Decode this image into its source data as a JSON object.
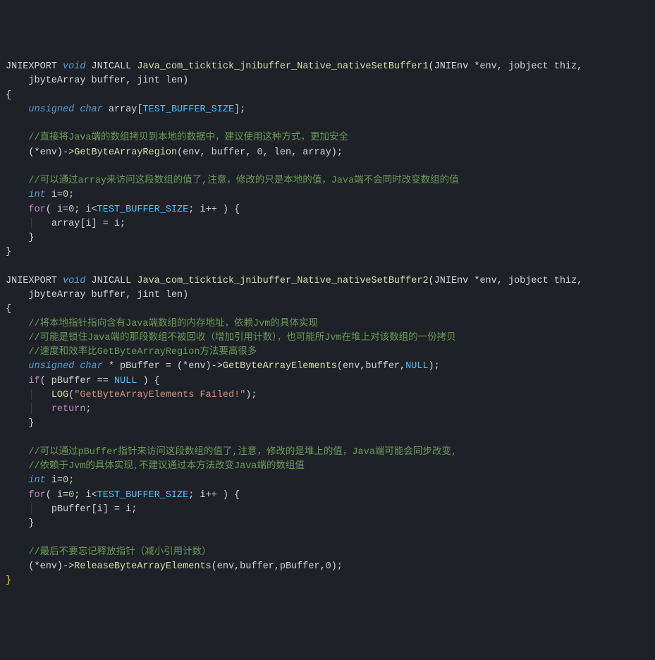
{
  "code": {
    "lines": [
      [
        {
          "t": "JNIEXPORT",
          "c": "ident"
        },
        {
          "t": " "
        },
        {
          "t": "void",
          "c": "kw-type"
        },
        {
          "t": " "
        },
        {
          "t": "JNICALL",
          "c": "ident"
        },
        {
          "t": " "
        },
        {
          "t": "Java_com_ticktick_jnibuffer_Native_nativeSetBuffer1",
          "c": "fn-name"
        },
        {
          "t": "(JNIEnv *env, jobject thiz, ",
          "c": "ident"
        }
      ],
      [
        {
          "t": "    jbyteArray buffer, jint len)",
          "c": "ident"
        }
      ],
      [
        {
          "t": "{",
          "c": "punc"
        }
      ],
      [
        {
          "t": "    "
        },
        {
          "t": "unsigned",
          "c": "kw-type"
        },
        {
          "t": " "
        },
        {
          "t": "char",
          "c": "kw-type"
        },
        {
          "t": " "
        },
        {
          "t": "array[",
          "c": "ident"
        },
        {
          "t": "TEST_BUFFER_SIZE",
          "c": "const"
        },
        {
          "t": "];",
          "c": "punc"
        }
      ],
      [
        {
          "t": " "
        }
      ],
      [
        {
          "t": "    "
        },
        {
          "t": "//直接将Java端的数组拷贝到本地的数据中，建议使用这种方式，更加安全",
          "c": "comment"
        }
      ],
      [
        {
          "t": "    (*env)->",
          "c": "ident"
        },
        {
          "t": "GetByteArrayRegion",
          "c": "fn-call"
        },
        {
          "t": "(env, buffer, ",
          "c": "ident"
        },
        {
          "t": "0",
          "c": "num"
        },
        {
          "t": ", len, array);",
          "c": "ident"
        }
      ],
      [
        {
          "t": " "
        }
      ],
      [
        {
          "t": "    "
        },
        {
          "t": "//可以通过array来访问这段数组的值了,注意，修改的只是本地的值，Java端不会同时改变数组的值",
          "c": "comment"
        }
      ],
      [
        {
          "t": "    "
        },
        {
          "t": "int",
          "c": "kw-type"
        },
        {
          "t": " "
        },
        {
          "t": "i=",
          "c": "ident"
        },
        {
          "t": "0",
          "c": "num"
        },
        {
          "t": ";",
          "c": "punc"
        }
      ],
      [
        {
          "t": "    "
        },
        {
          "t": "for",
          "c": "kw-ctrl"
        },
        {
          "t": "( i=",
          "c": "ident"
        },
        {
          "t": "0",
          "c": "num"
        },
        {
          "t": "; i<",
          "c": "ident"
        },
        {
          "t": "TEST_BUFFER_SIZE",
          "c": "const"
        },
        {
          "t": "; i++ ) {",
          "c": "ident"
        }
      ],
      [
        {
          "t": "    "
        },
        {
          "t": "│",
          "c": "indent-guide"
        },
        {
          "t": "   array[i] = i;",
          "c": "ident"
        }
      ],
      [
        {
          "t": "    }",
          "c": "punc"
        }
      ],
      [
        {
          "t": "}",
          "c": "punc"
        }
      ],
      [
        {
          "t": " "
        }
      ],
      [
        {
          "t": "JNIEXPORT",
          "c": "ident"
        },
        {
          "t": " "
        },
        {
          "t": "void",
          "c": "kw-type"
        },
        {
          "t": " "
        },
        {
          "t": "JNICALL",
          "c": "ident"
        },
        {
          "t": " "
        },
        {
          "t": "Java_com_ticktick_jnibuffer_Native_nativeSetBuffer2",
          "c": "fn-name"
        },
        {
          "t": "(JNIEnv *env, jobject thiz, ",
          "c": "ident"
        }
      ],
      [
        {
          "t": "    jbyteArray buffer, jint len)",
          "c": "ident"
        }
      ],
      [
        {
          "t": "{",
          "c": "punc"
        }
      ],
      [
        {
          "t": "    "
        },
        {
          "t": "//将本地指针指向含有Java端数组的内存地址，依赖Jvm的具体实现",
          "c": "comment"
        }
      ],
      [
        {
          "t": "    "
        },
        {
          "t": "//可能是锁住Java端的那段数组不被回收（增加引用计数），也可能所Jvm在堆上对该数组的一份拷贝",
          "c": "comment"
        }
      ],
      [
        {
          "t": "    "
        },
        {
          "t": "//速度和效率比GetByteArrayRegion方法要高很多",
          "c": "comment"
        }
      ],
      [
        {
          "t": "    "
        },
        {
          "t": "unsigned",
          "c": "kw-type"
        },
        {
          "t": " "
        },
        {
          "t": "char",
          "c": "kw-type"
        },
        {
          "t": " * pBuffer = (*env)->",
          "c": "ident"
        },
        {
          "t": "GetByteArrayElements",
          "c": "fn-call"
        },
        {
          "t": "(env,buffer,",
          "c": "ident"
        },
        {
          "t": "NULL",
          "c": "const"
        },
        {
          "t": ");",
          "c": "punc"
        }
      ],
      [
        {
          "t": "    "
        },
        {
          "t": "if",
          "c": "kw-ctrl"
        },
        {
          "t": "( pBuffer == ",
          "c": "ident"
        },
        {
          "t": "NULL",
          "c": "const"
        },
        {
          "t": " ) {",
          "c": "ident"
        }
      ],
      [
        {
          "t": "    "
        },
        {
          "t": "│",
          "c": "indent-guide"
        },
        {
          "t": "   "
        },
        {
          "t": "LOG",
          "c": "fn-call"
        },
        {
          "t": "(",
          "c": "punc"
        },
        {
          "t": "\"GetByteArrayElements Failed!\"",
          "c": "str"
        },
        {
          "t": ");",
          "c": "punc"
        }
      ],
      [
        {
          "t": "    "
        },
        {
          "t": "│",
          "c": "indent-guide"
        },
        {
          "t": "   "
        },
        {
          "t": "return",
          "c": "kw-ret"
        },
        {
          "t": ";",
          "c": "punc"
        }
      ],
      [
        {
          "t": "    }",
          "c": "punc"
        }
      ],
      [
        {
          "t": " "
        }
      ],
      [
        {
          "t": "    "
        },
        {
          "t": "//可以通过pBuffer指针来访问这段数组的值了,注意，修改的是堆上的值，Java端可能会同步改变,",
          "c": "comment"
        }
      ],
      [
        {
          "t": "    "
        },
        {
          "t": "//依赖于Jvm的具体实现,不建议通过本方法改变Java端的数组值",
          "c": "comment"
        }
      ],
      [
        {
          "t": "    "
        },
        {
          "t": "int",
          "c": "kw-type"
        },
        {
          "t": " "
        },
        {
          "t": "i=",
          "c": "ident"
        },
        {
          "t": "0",
          "c": "num"
        },
        {
          "t": ";",
          "c": "punc"
        }
      ],
      [
        {
          "t": "    "
        },
        {
          "t": "for",
          "c": "kw-ctrl"
        },
        {
          "t": "( i=",
          "c": "ident"
        },
        {
          "t": "0",
          "c": "num"
        },
        {
          "t": "; i<",
          "c": "ident"
        },
        {
          "t": "TEST_BUFFER_SIZE",
          "c": "const"
        },
        {
          "t": "; i++ ) {",
          "c": "ident"
        }
      ],
      [
        {
          "t": "    "
        },
        {
          "t": "│",
          "c": "indent-guide"
        },
        {
          "t": "   pBuffer[i] = i;",
          "c": "ident"
        }
      ],
      [
        {
          "t": "    }",
          "c": "punc"
        }
      ],
      [
        {
          "t": " "
        }
      ],
      [
        {
          "t": "    "
        },
        {
          "t": "//最后不要忘记释放指针（减小引用计数）",
          "c": "comment"
        }
      ],
      [
        {
          "t": "    (*env)->",
          "c": "ident"
        },
        {
          "t": "ReleaseByteArrayElements",
          "c": "fn-call"
        },
        {
          "t": "(env,buffer,pBuffer,",
          "c": "ident"
        },
        {
          "t": "0",
          "c": "num"
        },
        {
          "t": ");",
          "c": "punc"
        }
      ],
      [
        {
          "t": "}",
          "c": "brace-match"
        }
      ]
    ]
  }
}
